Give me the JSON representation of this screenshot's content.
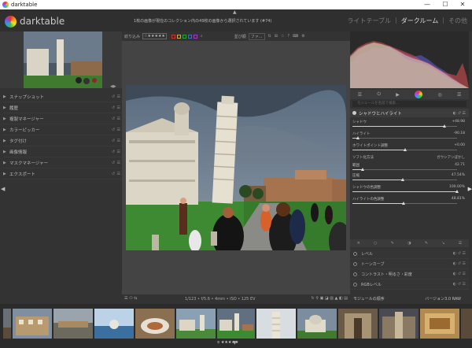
{
  "window": {
    "title": "darktable",
    "minimize": "—",
    "maximize": "☐",
    "close": "✕"
  },
  "header": {
    "brand": "darktable",
    "message": "1枚の画像が現在のコレクション内の49枚の画像から選択されています (#74)",
    "views": [
      "ライトテーブル",
      "|",
      "ダークルーム",
      "|",
      "その他"
    ],
    "active_view": "ダークルーム"
  },
  "toolbar": {
    "filter_label": "絞り込み",
    "stars": "☆★★★★★",
    "sort_label": "並び順",
    "sort_value": "ファ..."
  },
  "color_labels": [
    "#c0392b",
    "#c9b21e",
    "#2f9e41",
    "#3b6ad8",
    "#9b3fc2"
  ],
  "left_modules": [
    "スナップショット",
    "履歴",
    "複製マネージャー",
    "カラーピッカー",
    "タグ付け",
    "画像情報",
    "マスクマネージャー",
    "エクスポート"
  ],
  "right": {
    "search_placeholder": "モジュールを名前で検索...",
    "active_module": "シャドウとハイライト",
    "sliders": [
      {
        "label": "シャドウ",
        "value": "+48.98",
        "level": 0.88
      },
      {
        "label": "ハイライト",
        "value": "-90.18",
        "level": 0.05
      },
      {
        "label": "ホワイトポイント調整",
        "value": "+0.00",
        "level": 0.5
      },
      {
        "label": "ソフト化方法",
        "value": "ガウシアンぼかし",
        "level": null
      },
      {
        "label": "範囲",
        "value": "42.71",
        "level": 0.1
      },
      {
        "label": "圧縮",
        "value": "47.54%",
        "level": 0.48
      },
      {
        "label": "シャドウの色調整",
        "value": "100.00%",
        "level": 1.0
      },
      {
        "label": "ハイライトの色調整",
        "value": "48.81%",
        "level": 0.49
      }
    ],
    "modules": [
      "レベル",
      "トーンカーブ",
      "コントラスト・明るさ・彩度",
      "RGBレベル",
      "RGBカーブ",
      "カラーバランスRGB",
      "カラーキャリブレーション"
    ],
    "footer_left": "モジュールの順序",
    "footer_right": "バージョン3.0 RAW"
  },
  "bottom_bar": {
    "info": "1/123 • f/5.6 • 4mm • ISO • 125 EV"
  },
  "filmstrip": {
    "rating": "⦸ ★★★★★"
  }
}
